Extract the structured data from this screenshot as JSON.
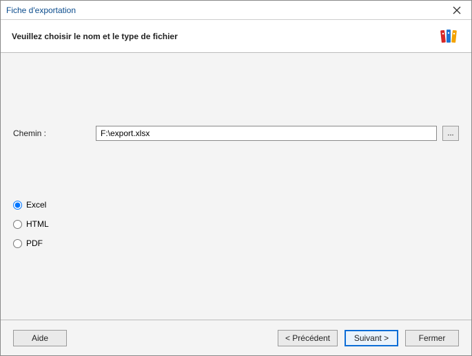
{
  "window": {
    "title": "Fiche d'exportation"
  },
  "header": {
    "subtitle": "Veuillez choisir le nom et le type de fichier"
  },
  "path": {
    "label": "Chemin :",
    "value": "F:\\export.xlsx",
    "browse": "..."
  },
  "formats": {
    "options": [
      {
        "label": "Excel",
        "value": "excel",
        "checked": true
      },
      {
        "label": "HTML",
        "value": "html",
        "checked": false
      },
      {
        "label": "PDF",
        "value": "pdf",
        "checked": false
      }
    ]
  },
  "buttons": {
    "help": "Aide",
    "previous": "< Précédent",
    "next": "Suivant >",
    "close": "Fermer"
  }
}
